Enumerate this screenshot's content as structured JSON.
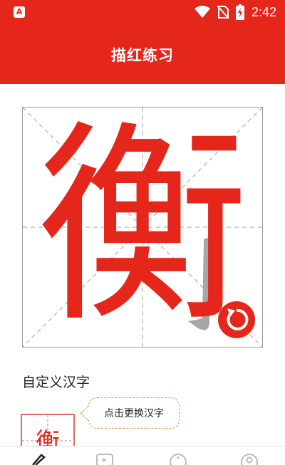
{
  "statusbar": {
    "app_badge": "A",
    "time": "2:42",
    "icons": [
      "wifi-icon",
      "no-sim-icon",
      "battery-charging-icon"
    ]
  },
  "header": {
    "title": "描红练习"
  },
  "practice": {
    "character": "衡",
    "replay_icon": "replay-icon"
  },
  "custom": {
    "section_title": "自定义汉字",
    "thumbnail_character": "衡",
    "tooltip": "点击更换汉字"
  },
  "tabbar": {
    "tabs": [
      {
        "icon": "brush-icon",
        "active": true
      },
      {
        "icon": "video-icon",
        "active": false
      },
      {
        "icon": "info-icon",
        "active": false
      },
      {
        "icon": "profile-icon",
        "active": false
      }
    ]
  },
  "colors": {
    "brand": "#e5261a",
    "trace_gray": "#a6a6a6",
    "tooltip_border": "#e4974e"
  }
}
